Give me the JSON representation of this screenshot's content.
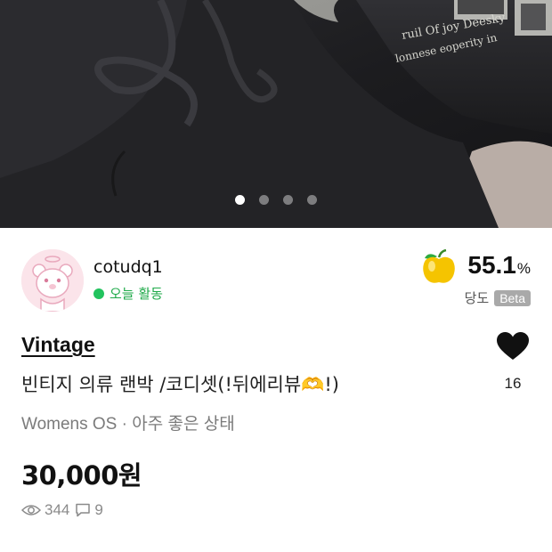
{
  "gallery": {
    "image_count": 4,
    "active_index": 0,
    "print_text_line1": "ruil Of joy Deesky",
    "print_text_line2": "lonnese eoperity in"
  },
  "seller": {
    "name": "cotudq1",
    "activity": "오늘 활동",
    "sweetness_value": "55.1",
    "sweetness_unit": "%",
    "sweetness_label": "당도",
    "beta_label": "Beta",
    "activity_color": "#22c35e"
  },
  "listing": {
    "brand": "Vintage",
    "title": "빈티지 의류 랜박 /코디셋(!뒤에리뷰🫶!)",
    "meta": "Womens OS · 아주 좋은 상태",
    "price": "30,000원",
    "likes": "16",
    "views": "344",
    "comments": "9"
  },
  "icons": {
    "sweetness": "yellow-apple-icon",
    "like": "heart-icon",
    "views": "eye-icon",
    "comments": "speech-bubble-icon"
  }
}
